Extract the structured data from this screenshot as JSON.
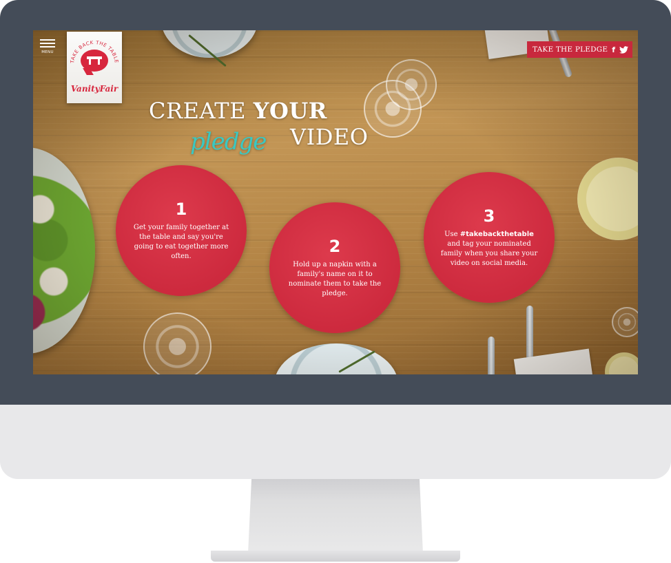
{
  "menu": {
    "label": "MENU"
  },
  "logo": {
    "tagline": "TAKE BACK THE TABLE",
    "brand": "VanityFair"
  },
  "cta": {
    "label": "TAKE THE PLEDGE",
    "facebook_icon": "f",
    "twitter_icon": "twitter"
  },
  "heading": {
    "line1_prefix": "CREATE",
    "line1_bold": "YOUR",
    "script_word": "pledge",
    "line2_suffix": "VIDEO"
  },
  "steps": [
    {
      "number": "1",
      "text": "Get your family together at the table and say you're going to eat together more often."
    },
    {
      "number": "2",
      "text": "Hold up a napkin with a family's name on it to nominate them to take the pledge."
    },
    {
      "number": "3",
      "text_before": "Use",
      "hashtag": "#takebackthetable",
      "text_after": "and tag your nominated family when you share your video on social media."
    }
  ],
  "colors": {
    "accent_red": "#d7263d",
    "script_teal": "#3ac8c2",
    "frame": "#444c58"
  }
}
